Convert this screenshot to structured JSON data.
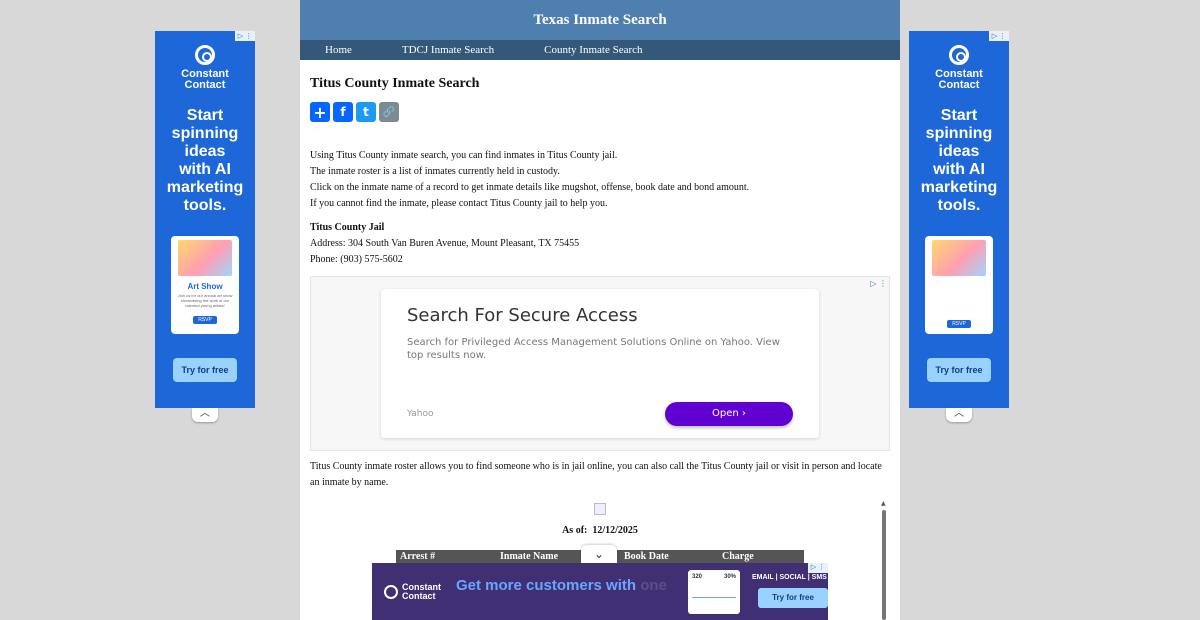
{
  "header": {
    "title": "Texas Inmate Search"
  },
  "nav": {
    "items": [
      "Home",
      "TDCJ Inmate Search",
      "County Inmate Search"
    ]
  },
  "page": {
    "title": "Titus County Inmate Search",
    "intro": [
      "Using Titus County inmate search, you can find inmates in Titus County jail.",
      "The inmate roster is a list of inmates currently held in custody.",
      "Click on the inmate name of a record to get inmate details like mugshot, offense, book date and bond amount.",
      "If you cannot find the inmate, please contact Titus County jail to help you."
    ],
    "jail_name": "Titus County Jail",
    "address": "Address: 304 South Van Buren Avenue, Mount Pleasant, TX 75455",
    "phone": "Phone: (903) 575-5602",
    "roster_text": "Titus County inmate roster allows you to find someone who is in jail online, you can also call the Titus County jail or visit in person and locate an inmate by name.",
    "as_of_label": "As of:",
    "as_of_date": "12/12/2025",
    "table_headers": [
      "Arrest #",
      "Inmate Name",
      "Book Date",
      "Charge"
    ]
  },
  "share": {
    "icons": [
      "share-plus-icon",
      "facebook-icon",
      "twitter-icon",
      "copy-link-icon"
    ],
    "glyphs": [
      "+",
      "f",
      "t",
      "🔗"
    ]
  },
  "side_ad": {
    "brand_line1": "Constant",
    "brand_line2": "Contact",
    "headline_lines": [
      "Start",
      "spinning",
      "ideas",
      "with AI",
      "marketing",
      "tools."
    ],
    "card_title": "Art Show",
    "card_text": "Join us for our annual art show showcasing the work of our talented young artists!",
    "card_button": "RSVP",
    "cta": "Try for free",
    "ad_choices": "▷ ⋮",
    "collapse": "︿"
  },
  "mid_ad": {
    "title": "Search For Secure Access",
    "description": "Search for Privileged Access Management Solutions Online on Yahoo. View top results now.",
    "source": "Yahoo",
    "button": "Open  ›",
    "ad_choices": "▷ ⋮"
  },
  "bottom_ad": {
    "brand_line1": "Constant",
    "brand_line2": "Contact",
    "headline": "Get more customers with",
    "headline_dim": " one",
    "stat1": "320",
    "stat2": "30%",
    "channels": "EMAIL  |  SOCIAL  |  SMS",
    "cta": "Try for free",
    "toggle": "⌄",
    "ad_choices": "▷ ⋮"
  },
  "colors": {
    "header_bg": "#4f7fae",
    "nav_bg": "#34587a",
    "ad_blue": "#1d67d9",
    "open_button": "#6001d2"
  }
}
